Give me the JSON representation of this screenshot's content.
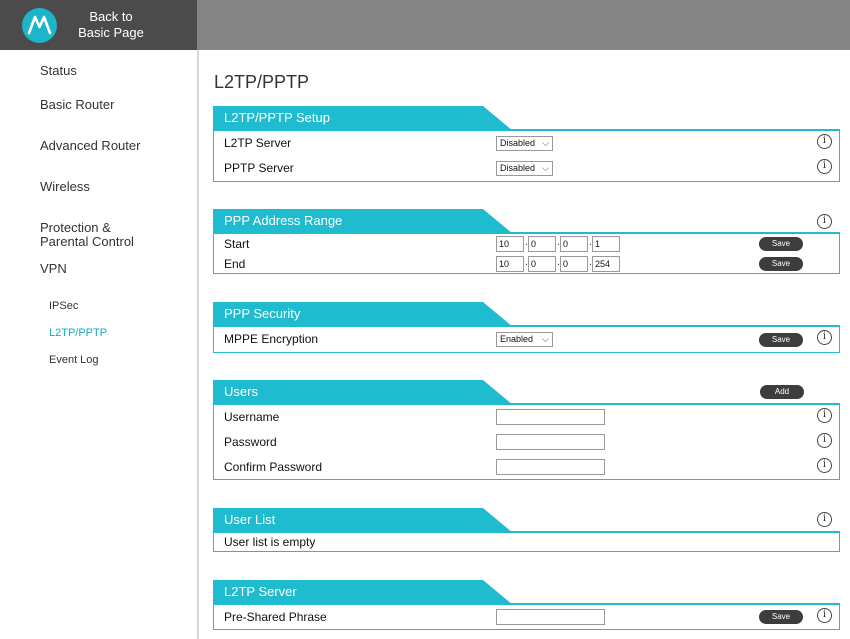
{
  "header": {
    "back_line1": "Back to",
    "back_line2": "Basic Page",
    "logo_icon": "motorola-logo-icon"
  },
  "sidebar": {
    "items": [
      {
        "label": "Status"
      },
      {
        "label": "Basic Router"
      },
      {
        "label": "Advanced Router"
      },
      {
        "label": "Wireless"
      },
      {
        "label": "Protection &",
        "label2": "Parental Control"
      },
      {
        "label": "VPN"
      }
    ],
    "sub_items": [
      {
        "label": "IPSec",
        "active": false
      },
      {
        "label": "L2TP/PPTP",
        "active": true
      },
      {
        "label": "Event Log",
        "active": false
      }
    ]
  },
  "page_title": "L2TP/PPTP",
  "colors": {
    "accent": "#1fbccf",
    "active_link": "#17a9bd",
    "button": "#3d3d3d"
  },
  "setup": {
    "title": "L2TP/PPTP Setup",
    "l2tp_label": "L2TP Server",
    "l2tp_value": "Disabled",
    "pptp_label": "PPTP Server",
    "pptp_value": "Disabled"
  },
  "range": {
    "title": "PPP Address Range",
    "start_label": "Start",
    "start": [
      "10",
      "0",
      "0",
      "1"
    ],
    "end_label": "End",
    "end": [
      "10",
      "0",
      "0",
      "254"
    ],
    "save_label": "Save"
  },
  "security": {
    "title": "PPP Security",
    "mppe_label": "MPPE Encryption",
    "mppe_value": "Enabled",
    "save_label": "Save"
  },
  "users": {
    "title": "Users",
    "add_label": "Add",
    "username_label": "Username",
    "password_label": "Password",
    "confirm_label": "Confirm Password"
  },
  "user_list": {
    "title": "User List",
    "empty_text": "User list is empty"
  },
  "l2tp_server": {
    "title": "L2TP Server",
    "phrase_label": "Pre-Shared Phrase",
    "save_label": "Save"
  },
  "info_glyph": "i",
  "caret_glyph": "⌵",
  "dot": "."
}
